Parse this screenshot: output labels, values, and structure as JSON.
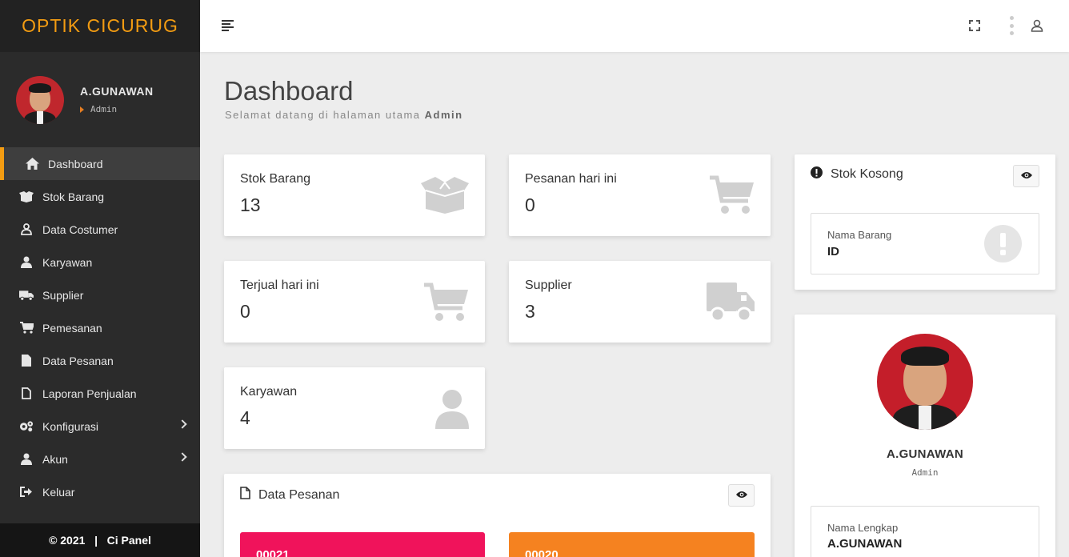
{
  "app": {
    "brand": "OPTIK CICURUG"
  },
  "user": {
    "name": "A.GUNAWAN",
    "role": "Admin"
  },
  "sidebar": {
    "items": [
      {
        "label": "Dashboard",
        "icon": "home-icon",
        "active": true
      },
      {
        "label": "Stok Barang",
        "icon": "box-open-icon"
      },
      {
        "label": "Data Costumer",
        "icon": "user-outline-icon"
      },
      {
        "label": "Karyawan",
        "icon": "user-icon"
      },
      {
        "label": "Supplier",
        "icon": "truck-icon"
      },
      {
        "label": "Pemesanan",
        "icon": "cart-icon"
      },
      {
        "label": "Data Pesanan",
        "icon": "file-icon"
      },
      {
        "label": "Laporan Penjualan",
        "icon": "file-outline-icon"
      },
      {
        "label": "Konfigurasi",
        "icon": "cogs-icon",
        "has_submenu": true
      },
      {
        "label": "Akun",
        "icon": "user-icon",
        "has_submenu": true
      },
      {
        "label": "Keluar",
        "icon": "sign-out-icon"
      }
    ],
    "footer": "© 2021   |   Ci Panel"
  },
  "page": {
    "title": "Dashboard",
    "subtitle_prefix": "Selamat datang di halaman utama ",
    "subtitle_user": "Admin"
  },
  "stats": [
    {
      "label": "Stok Barang",
      "value": "13",
      "icon": "box-open-icon"
    },
    {
      "label": "Pesanan hari ini",
      "value": "0",
      "icon": "cart-icon"
    },
    {
      "label": "Terjual hari ini",
      "value": "0",
      "icon": "cart-icon"
    },
    {
      "label": "Supplier",
      "value": "3",
      "icon": "truck-icon"
    },
    {
      "label": "Karyawan",
      "value": "4",
      "icon": "user-icon"
    }
  ],
  "data_pesanan": {
    "title": "Data Pesanan",
    "tiles": [
      {
        "code": "00021",
        "color": "#f0135b"
      },
      {
        "code": "00020",
        "color": "#f58220"
      }
    ]
  },
  "stok_kosong": {
    "title": "Stok Kosong",
    "item_label": "Nama Barang",
    "item_value": "ID"
  },
  "profile": {
    "name": "A.GUNAWAN",
    "role": "Admin",
    "field_label": "Nama Lengkap",
    "field_value": "A.GUNAWAN"
  },
  "colors": {
    "accent": "#f39c12",
    "sidebar_bg": "#2b2b2b",
    "icon_gray": "#d0d0d0"
  }
}
